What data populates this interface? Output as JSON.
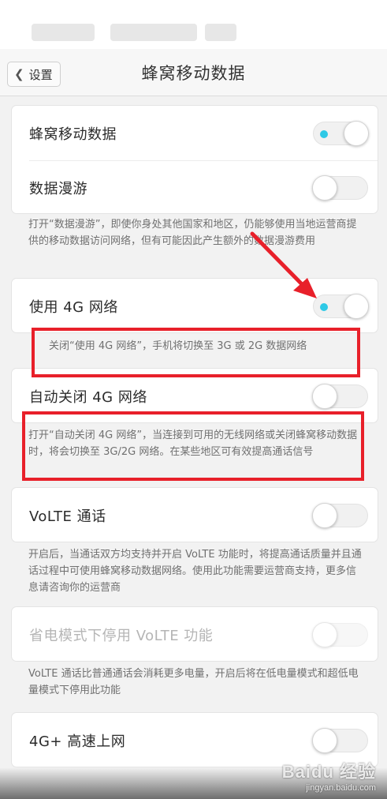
{
  "header": {
    "back_label": "设置",
    "title": "蜂窝移动数据"
  },
  "sections": {
    "cellular": {
      "rows": [
        {
          "label": "蜂窝移动数据",
          "state": "on"
        },
        {
          "label": "数据漫游",
          "state": "off"
        }
      ],
      "description": "打开“数据漫游”，即使你身处其他国家和地区，仍能够使用当地运营商提供的移动数据访问网络，但有可能因此产生额外的数据漫游费用"
    },
    "network_4g": {
      "label": "使用 4G 网络",
      "state": "on",
      "description": "关闭“使用 4G 网络”，手机将切换至 3G 或 2G 数据网络"
    },
    "auto_close_4g": {
      "label": "自动关闭 4G 网络",
      "state": "off",
      "description": "打开“自动关闭 4G 网络”，当连接到可用的无线网络或关闭蜂窝移动数据时，将会切换至 3G/2G 网络。在某些地区可有效提高通话信号"
    },
    "volte": {
      "label": "VoLTE 通话",
      "state": "off",
      "description": "开启后，当通话双方均支持并开启 VoLTE 功能时，将提高通话质量并且通话过程中可使用蜂窝移动数据网络。使用此功能需要运营商支持，更多信息请咨询你的运营商"
    },
    "power_saving_volte": {
      "label": "省电模式下停用 VoLTE 功能",
      "state": "disabled",
      "description": "VoLTE 通话比普通通话会消耗更多电量，开启后将在低电量模式和超低电量模式下停用此功能"
    },
    "4g_plus": {
      "label": "4G+ 高速上网",
      "state": "off"
    }
  },
  "colors": {
    "toggle_on_dot": "#2ec9e6",
    "annotation_red": "#e8202a",
    "background": "#f2f2f2"
  },
  "watermark": {
    "brand": "Baidu 经验",
    "domain": "jingyan.baidu.com"
  }
}
